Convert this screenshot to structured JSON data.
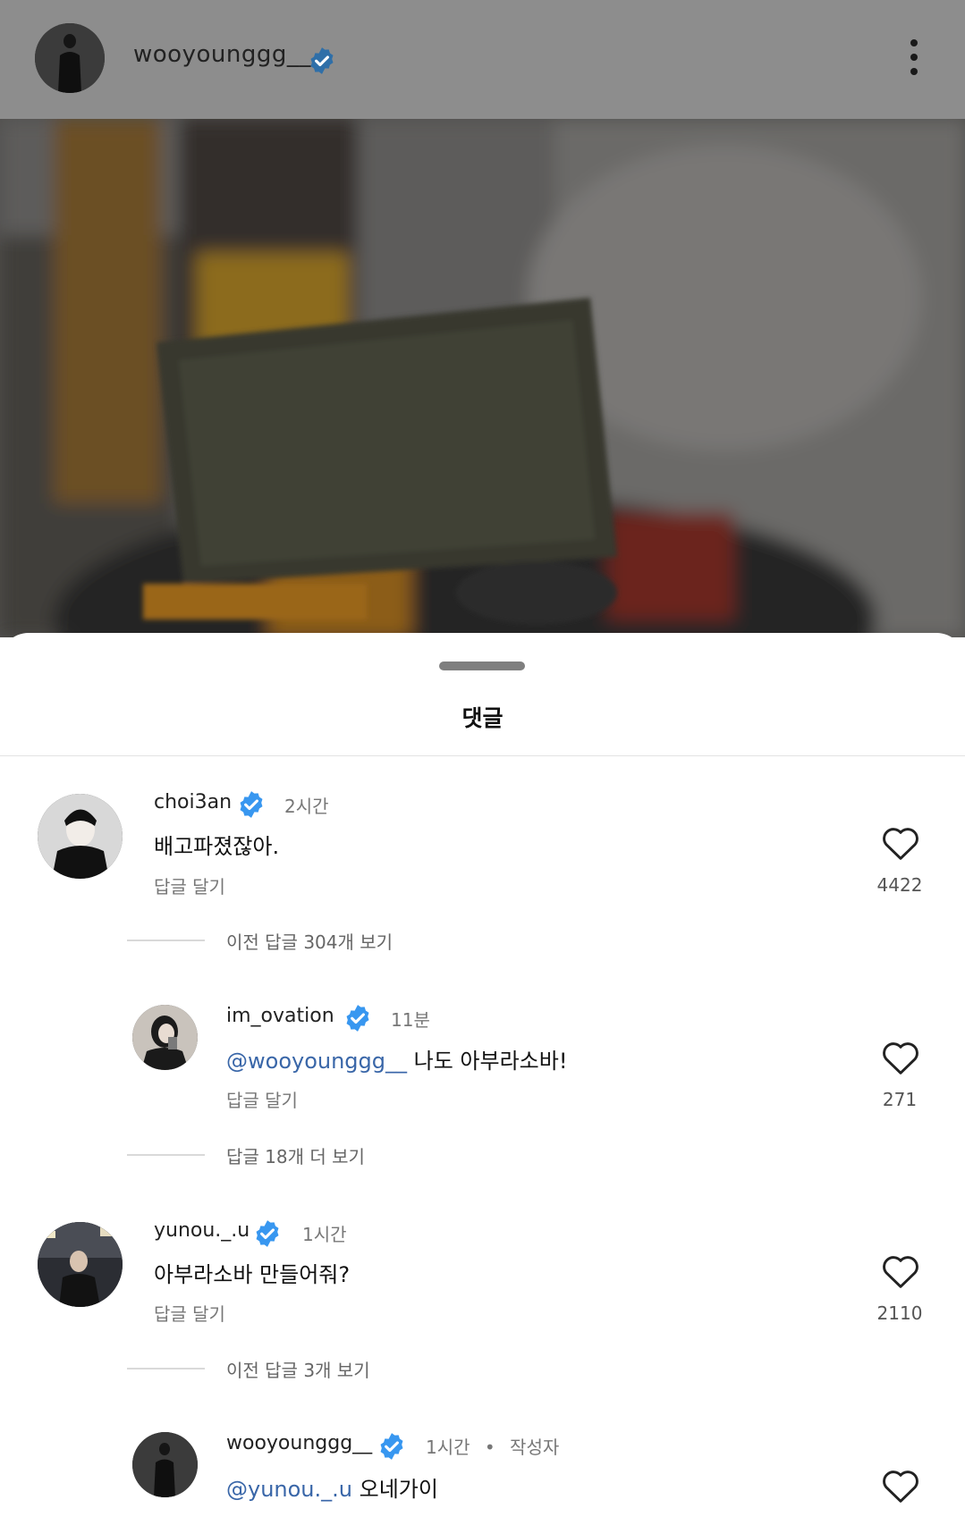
{
  "post": {
    "username": "wooyounggg__",
    "verified": true
  },
  "sheet": {
    "title": "댓글"
  },
  "comments": [
    {
      "username": "choi3an",
      "time": "2시간",
      "text": "배고파졌잖아.",
      "reply_label": "답글 달기",
      "likes": "4422",
      "thread_label": "이전 답글 304개 보기"
    },
    {
      "username": "im_ovation",
      "time": "11분",
      "mention": "@wooyounggg__",
      "text": " 나도 아부라소바!",
      "reply_label": "답글 달기",
      "likes": "271",
      "thread_label": "답글 18개 더 보기"
    },
    {
      "username": "yunou._.u",
      "time": "1시간",
      "text": "아부라소바 만들어줘?",
      "reply_label": "답글 달기",
      "likes": "2110",
      "thread_label": "이전 답글 3개 보기"
    },
    {
      "username": "wooyounggg__",
      "time": "1시간",
      "author_tag": "작성자",
      "mention": "@yunou._.u",
      "text": " 오네가이"
    }
  ],
  "colors": {
    "verified_badge": "#3897f0",
    "mention": "#3966a8",
    "overlay": "#8d8d8d"
  },
  "icons": [
    "verified-badge-icon",
    "more-options-icon",
    "heart-icon"
  ]
}
